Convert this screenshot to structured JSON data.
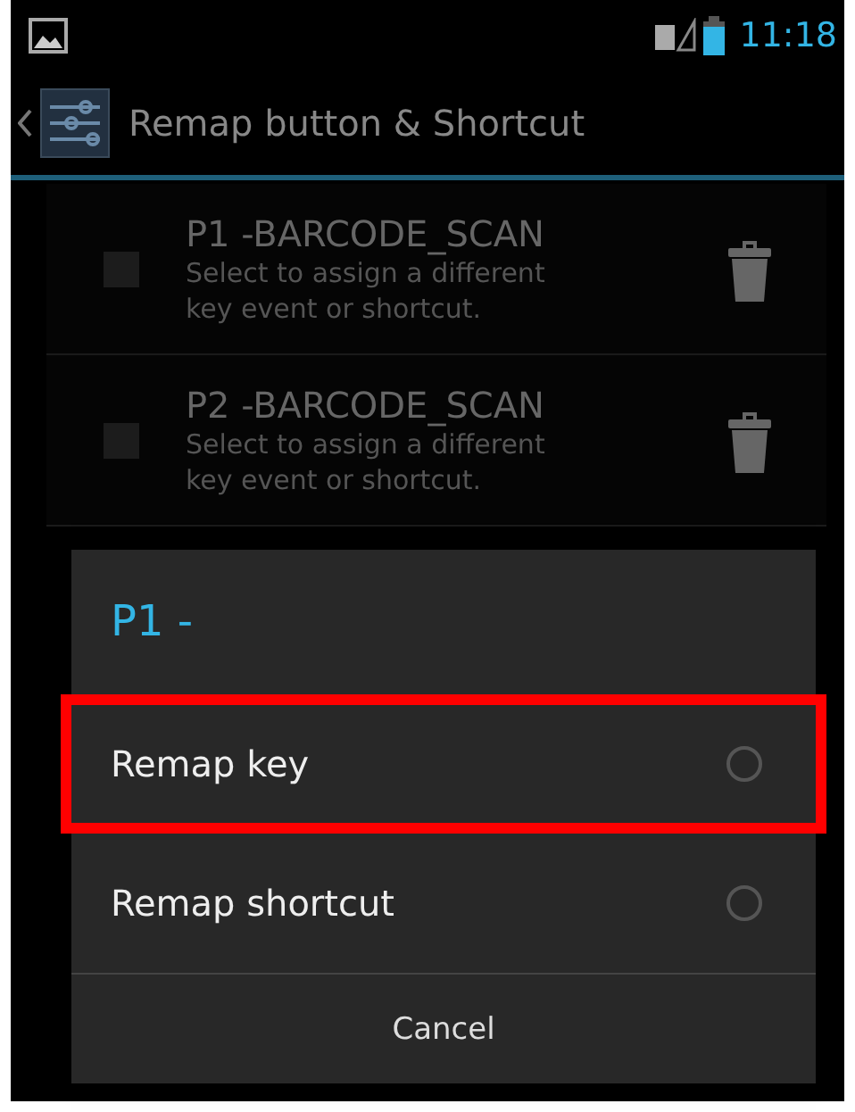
{
  "status_bar": {
    "time": "11:18"
  },
  "action_bar": {
    "title": "Remap button & Shortcut"
  },
  "items": [
    {
      "title": "P1 -BARCODE_SCAN",
      "summary": "Select to assign a different key event or shortcut.",
      "checked": false
    },
    {
      "title": "P2 -BARCODE_SCAN",
      "summary": "Select to assign a different key event or shortcut.",
      "checked": false
    }
  ],
  "dialog": {
    "title": "P1 -",
    "options": [
      {
        "label": "Remap key",
        "selected": false,
        "highlighted": true
      },
      {
        "label": "Remap shortcut",
        "selected": false,
        "highlighted": false
      }
    ],
    "button": "Cancel"
  }
}
